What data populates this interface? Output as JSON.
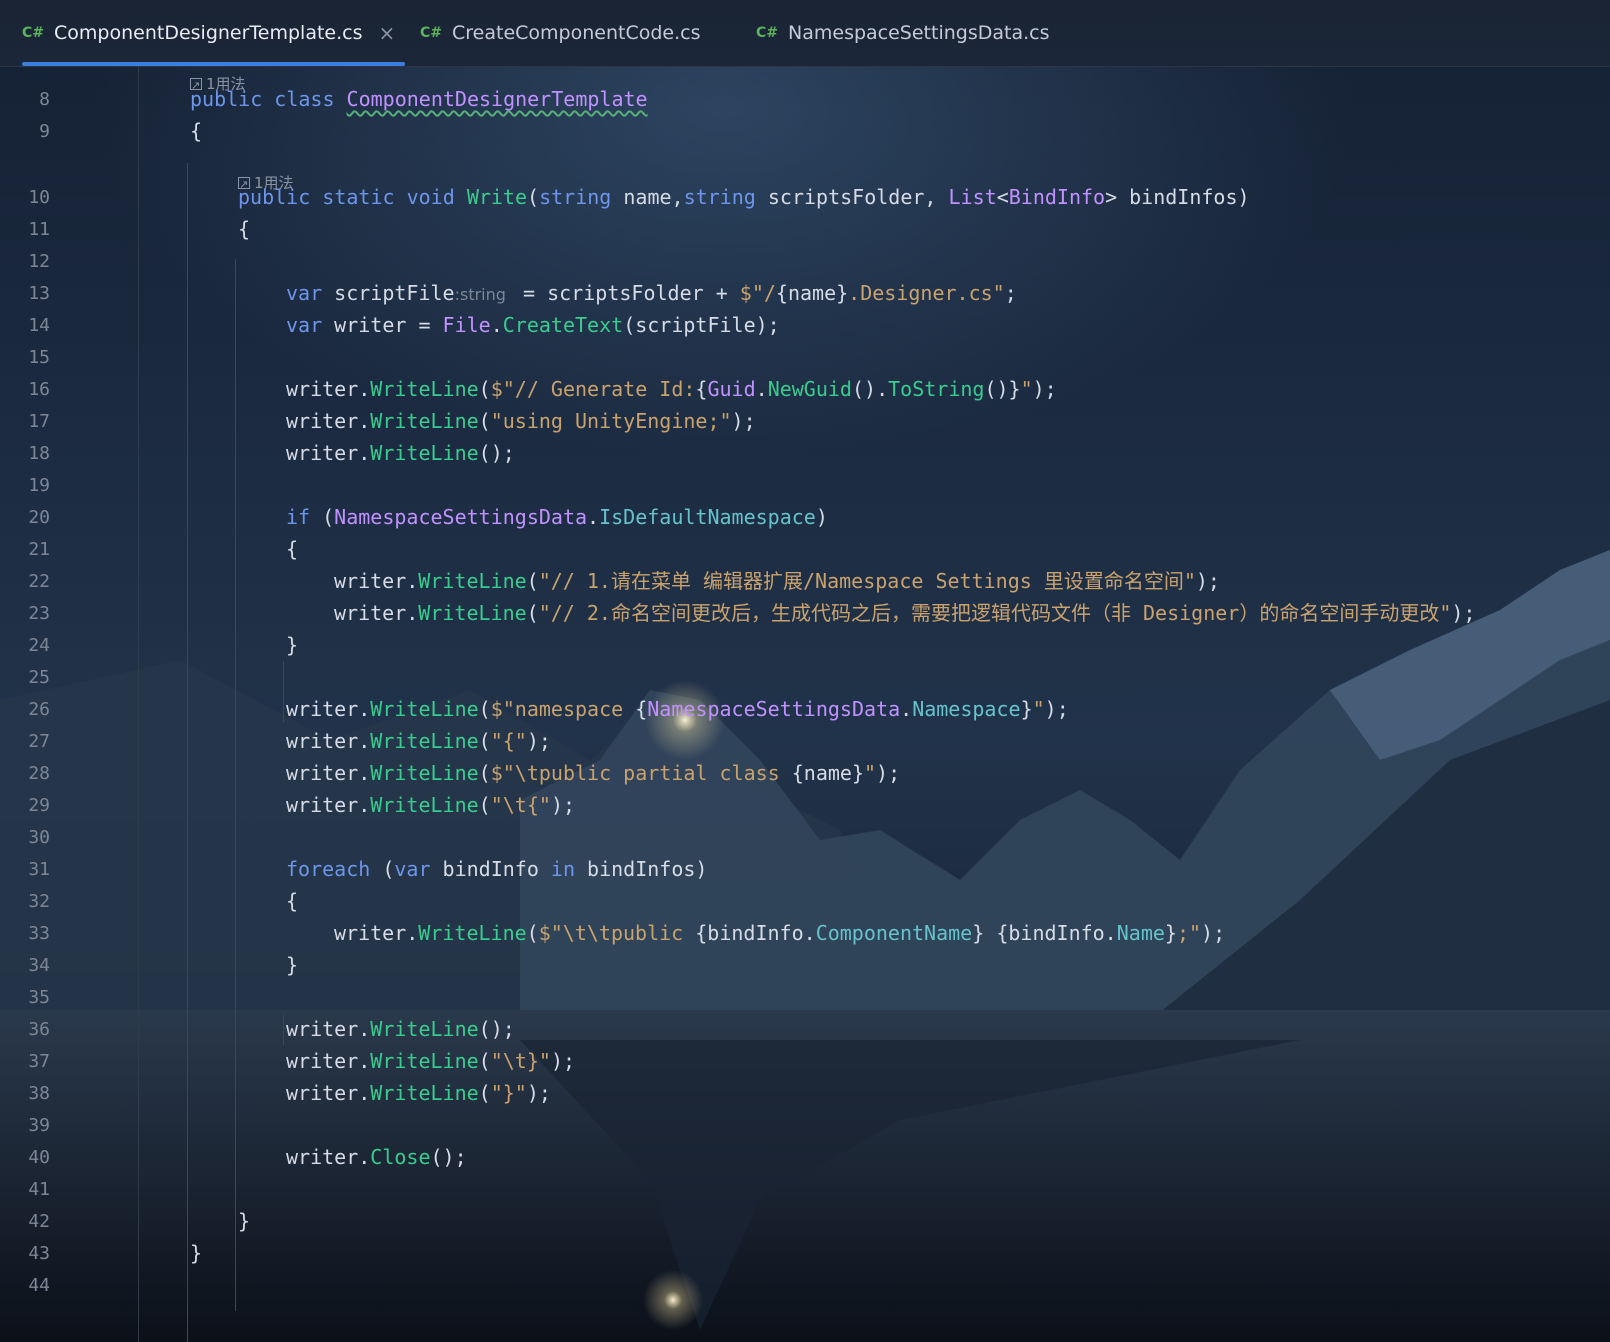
{
  "tabs": [
    {
      "lang": "C#",
      "label": "ComponentDesignerTemplate.cs",
      "active": true,
      "close": "×"
    },
    {
      "lang": "C#",
      "label": "CreateComponentCode.cs",
      "active": false
    },
    {
      "lang": "C#",
      "label": "NamespaceSettingsData.cs",
      "active": false
    }
  ],
  "usage_hints": [
    "1用法",
    "1用法"
  ],
  "line_numbers": [
    "8",
    "9",
    "10",
    "11",
    "12",
    "13",
    "14",
    "15",
    "16",
    "17",
    "18",
    "19",
    "20",
    "21",
    "22",
    "23",
    "24",
    "25",
    "26",
    "27",
    "28",
    "29",
    "30",
    "31",
    "32",
    "33",
    "34",
    "35",
    "36",
    "37",
    "38",
    "39",
    "40",
    "41",
    "42",
    "43",
    "44"
  ],
  "code": [
    [
      [
        "kw",
        "public "
      ],
      [
        "kw",
        "class "
      ],
      [
        "cls",
        "ComponentDesignerTemplate"
      ]
    ],
    [
      [
        "id",
        "{"
      ]
    ],
    [
      [
        "kw",
        "public "
      ],
      [
        "kw",
        "static "
      ],
      [
        "kw",
        "void "
      ],
      [
        "fn",
        "Write"
      ],
      [
        "id",
        "("
      ],
      [
        "kw",
        "string "
      ],
      [
        "id",
        "name,"
      ],
      [
        "kw",
        "string "
      ],
      [
        "id",
        "scriptsFolder, "
      ],
      [
        "ty",
        "List"
      ],
      [
        "id",
        "<"
      ],
      [
        "ty",
        "BindInfo"
      ],
      [
        "id",
        "> bindInfos)"
      ]
    ],
    [
      [
        "id",
        "{"
      ]
    ],
    [],
    [
      [
        "kw",
        "var "
      ],
      [
        "id",
        "scriptFile"
      ],
      [
        "inlay",
        ":string "
      ],
      [
        "id",
        " = scriptsFolder + "
      ],
      [
        "str",
        "$\"/"
      ],
      [
        "id",
        "{name}"
      ],
      [
        "str",
        ".Designer.cs\""
      ],
      [
        "id",
        ";"
      ]
    ],
    [
      [
        "kw",
        "var "
      ],
      [
        "id",
        "writer = "
      ],
      [
        "ty",
        "File"
      ],
      [
        "id",
        "."
      ],
      [
        "fn",
        "CreateText"
      ],
      [
        "id",
        "(scriptFile);"
      ]
    ],
    [],
    [
      [
        "id",
        "writer."
      ],
      [
        "fn",
        "WriteLine"
      ],
      [
        "id",
        "("
      ],
      [
        "str",
        "$\"// Generate Id:"
      ],
      [
        "id",
        "{"
      ],
      [
        "ty",
        "Guid"
      ],
      [
        "id",
        "."
      ],
      [
        "fn",
        "NewGuid"
      ],
      [
        "id",
        "()."
      ],
      [
        "fn",
        "ToString"
      ],
      [
        "id",
        "()}"
      ],
      [
        "str",
        "\""
      ],
      [
        "id",
        ");"
      ]
    ],
    [
      [
        "id",
        "writer."
      ],
      [
        "fn",
        "WriteLine"
      ],
      [
        "id",
        "("
      ],
      [
        "str",
        "\"using UnityEngine;\""
      ],
      [
        "id",
        ");"
      ]
    ],
    [
      [
        "id",
        "writer."
      ],
      [
        "fn",
        "WriteLine"
      ],
      [
        "id",
        "();"
      ]
    ],
    [],
    [
      [
        "kw",
        "if "
      ],
      [
        "id",
        "("
      ],
      [
        "ty",
        "NamespaceSettingsData"
      ],
      [
        "id",
        "."
      ],
      [
        "prop",
        "IsDefaultNamespace"
      ],
      [
        "id",
        ")"
      ]
    ],
    [
      [
        "id",
        "{"
      ]
    ],
    [
      [
        "id",
        "writer."
      ],
      [
        "fn",
        "WriteLine"
      ],
      [
        "id",
        "("
      ],
      [
        "str",
        "\"// 1.请在菜单 编辑器扩展/Namespace Settings 里设置命名空间\""
      ],
      [
        "id",
        ");"
      ]
    ],
    [
      [
        "id",
        "writer."
      ],
      [
        "fn",
        "WriteLine"
      ],
      [
        "id",
        "("
      ],
      [
        "str",
        "\"// 2.命名空间更改后，生成代码之后，需要把逻辑代码文件（非 Designer）的命名空间手动更改\""
      ],
      [
        "id",
        ");"
      ]
    ],
    [
      [
        "id",
        "}"
      ]
    ],
    [],
    [
      [
        "id",
        "writer."
      ],
      [
        "fn",
        "WriteLine"
      ],
      [
        "id",
        "("
      ],
      [
        "str",
        "$\"namespace "
      ],
      [
        "id",
        "{"
      ],
      [
        "ty",
        "NamespaceSettingsData"
      ],
      [
        "id",
        "."
      ],
      [
        "prop",
        "Namespace"
      ],
      [
        "id",
        "}"
      ],
      [
        "str",
        "\""
      ],
      [
        "id",
        ");"
      ]
    ],
    [
      [
        "id",
        "writer."
      ],
      [
        "fn",
        "WriteLine"
      ],
      [
        "id",
        "("
      ],
      [
        "str",
        "\"{\""
      ],
      [
        "id",
        ");"
      ]
    ],
    [
      [
        "id",
        "writer."
      ],
      [
        "fn",
        "WriteLine"
      ],
      [
        "id",
        "("
      ],
      [
        "str",
        "$\"\\tpublic partial class "
      ],
      [
        "id",
        "{name}"
      ],
      [
        "str",
        "\""
      ],
      [
        "id",
        ");"
      ]
    ],
    [
      [
        "id",
        "writer."
      ],
      [
        "fn",
        "WriteLine"
      ],
      [
        "id",
        "("
      ],
      [
        "str",
        "\"\\t{\""
      ],
      [
        "id",
        ");"
      ]
    ],
    [],
    [
      [
        "kw",
        "foreach "
      ],
      [
        "id",
        "("
      ],
      [
        "kw",
        "var "
      ],
      [
        "id",
        "bindInfo "
      ],
      [
        "kw",
        "in "
      ],
      [
        "id",
        "bindInfos)"
      ]
    ],
    [
      [
        "id",
        "{"
      ]
    ],
    [
      [
        "id",
        "writer."
      ],
      [
        "fn",
        "WriteLine"
      ],
      [
        "id",
        "("
      ],
      [
        "str",
        "$\"\\t\\tpublic "
      ],
      [
        "id",
        "{bindInfo."
      ],
      [
        "prop",
        "ComponentName"
      ],
      [
        "id",
        "} {bindInfo."
      ],
      [
        "prop",
        "Name"
      ],
      [
        "id",
        "}"
      ],
      [
        "str",
        ";\""
      ],
      [
        "id",
        ");"
      ]
    ],
    [
      [
        "id",
        "}"
      ]
    ],
    [],
    [
      [
        "id",
        "writer."
      ],
      [
        "fn",
        "WriteLine"
      ],
      [
        "id",
        "();"
      ]
    ],
    [
      [
        "id",
        "writer."
      ],
      [
        "fn",
        "WriteLine"
      ],
      [
        "id",
        "("
      ],
      [
        "str",
        "\"\\t}\""
      ],
      [
        "id",
        ");"
      ]
    ],
    [
      [
        "id",
        "writer."
      ],
      [
        "fn",
        "WriteLine"
      ],
      [
        "id",
        "("
      ],
      [
        "str",
        "\"}\""
      ],
      [
        "id",
        ");"
      ]
    ],
    [],
    [
      [
        "id",
        "writer."
      ],
      [
        "fn",
        "Close"
      ],
      [
        "id",
        "();"
      ]
    ],
    [],
    [
      [
        "id",
        "}"
      ]
    ],
    [
      [
        "id",
        "}"
      ]
    ],
    []
  ]
}
